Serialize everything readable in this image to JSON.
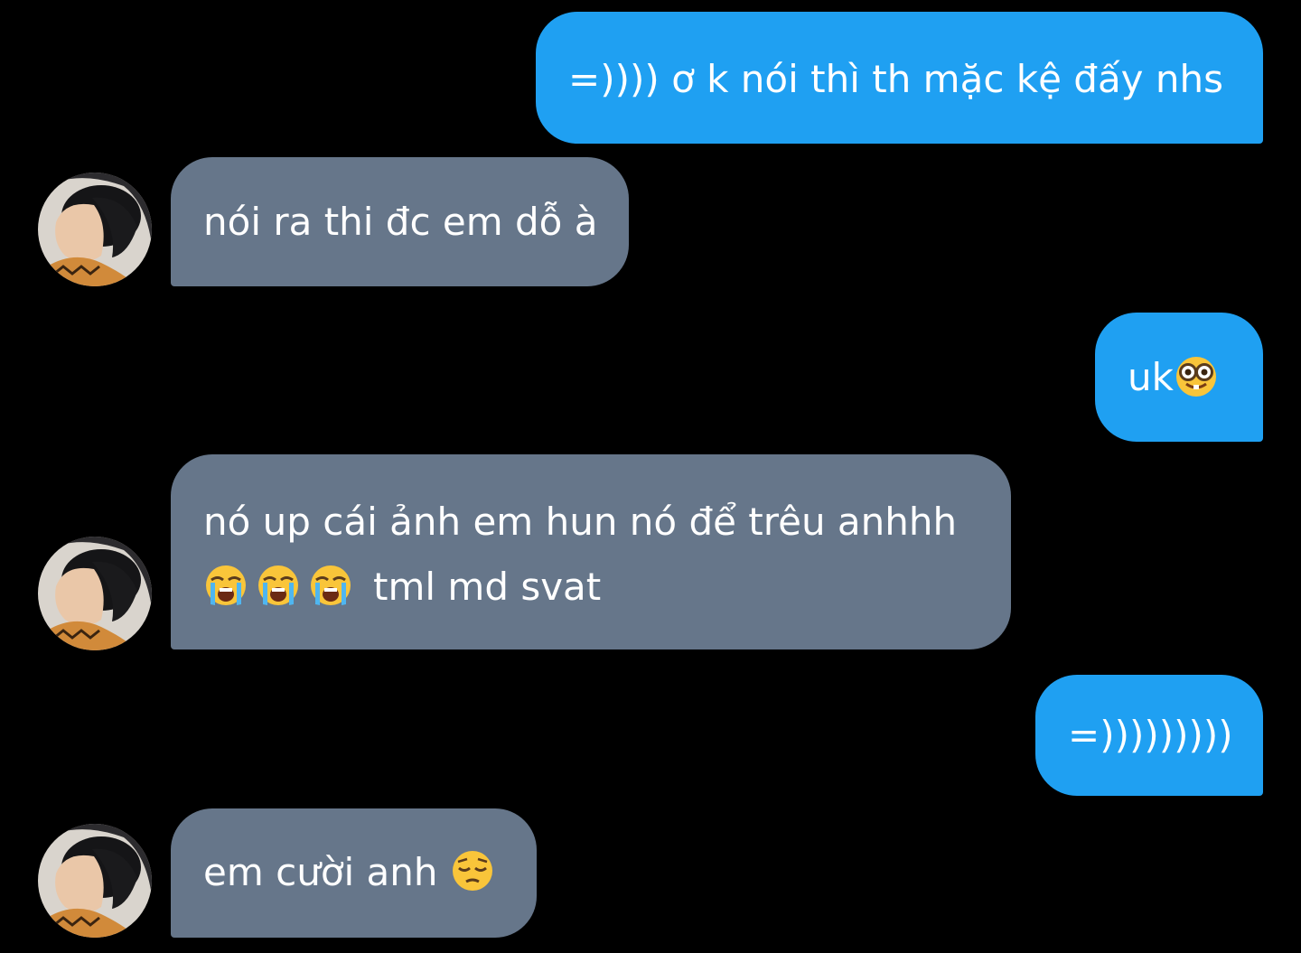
{
  "conversation": {
    "messages": [
      {
        "direction": "outgoing",
        "text": "=)))) ơ k nói thì th mặc kệ đấy nhs"
      },
      {
        "direction": "incoming",
        "text": "nói ra thi đc em dỗ à"
      },
      {
        "direction": "outgoing",
        "text": "uk",
        "emoji": [
          "nerd-face-emoji"
        ]
      },
      {
        "direction": "incoming",
        "text_line1": "nó up cái ảnh em hun nó để trêu anhhh",
        "text_line2": "tml md svat",
        "emoji": [
          "loudly-crying-face-emoji",
          "loudly-crying-face-emoji",
          "loudly-crying-face-emoji"
        ]
      },
      {
        "direction": "outgoing",
        "text": "=)))))))))"
      },
      {
        "direction": "incoming",
        "text": "em cười anh ",
        "emoji": [
          "pensive-face-emoji"
        ]
      }
    ]
  },
  "colors": {
    "background": "#000000",
    "outgoing_bubble": "#1fa0f2",
    "incoming_bubble": "#66768a",
    "text": "#ffffff"
  }
}
